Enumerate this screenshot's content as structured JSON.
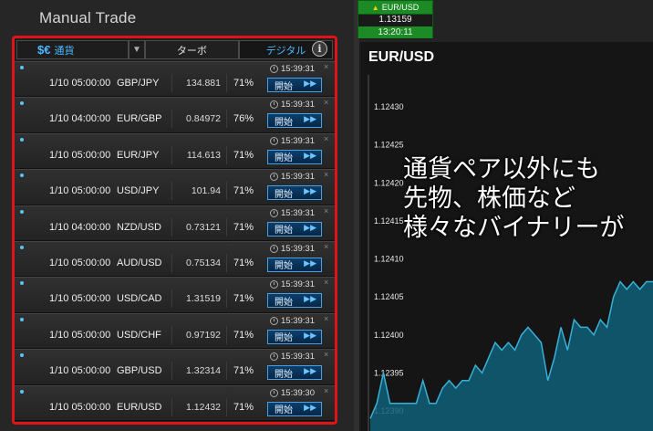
{
  "panel": {
    "title": "Manual Trade"
  },
  "tabs": {
    "currency_symbol": "$€",
    "currency_label": "通貨",
    "dropdown": "▼",
    "turbo": "ターボ",
    "digital": "デジタル",
    "info": "i"
  },
  "trades": [
    {
      "date": "1/10 05:00:00",
      "pair": "GBP/JPY",
      "rate": "134.881",
      "payout": "71%",
      "time": "15:39:31",
      "button": "開始"
    },
    {
      "date": "1/10 04:00:00",
      "pair": "EUR/GBP",
      "rate": "0.84972",
      "payout": "76%",
      "time": "15:39:31",
      "button": "開始"
    },
    {
      "date": "1/10 05:00:00",
      "pair": "EUR/JPY",
      "rate": "114.613",
      "payout": "71%",
      "time": "15:39:31",
      "button": "開始"
    },
    {
      "date": "1/10 05:00:00",
      "pair": "USD/JPY",
      "rate": "101.94",
      "payout": "71%",
      "time": "15:39:31",
      "button": "開始"
    },
    {
      "date": "1/10 04:00:00",
      "pair": "NZD/USD",
      "rate": "0.73121",
      "payout": "71%",
      "time": "15:39:31",
      "button": "開始"
    },
    {
      "date": "1/10 05:00:00",
      "pair": "AUD/USD",
      "rate": "0.75134",
      "payout": "71%",
      "time": "15:39:31",
      "button": "開始"
    },
    {
      "date": "1/10 05:00:00",
      "pair": "USD/CAD",
      "rate": "1.31519",
      "payout": "71%",
      "time": "15:39:31",
      "button": "開始"
    },
    {
      "date": "1/10 05:00:00",
      "pair": "USD/CHF",
      "rate": "0.97192",
      "payout": "71%",
      "time": "15:39:31",
      "button": "開始"
    },
    {
      "date": "1/10 05:00:00",
      "pair": "GBP/USD",
      "rate": "1.32314",
      "payout": "71%",
      "time": "15:39:31",
      "button": "開始"
    },
    {
      "date": "1/10 05:00:00",
      "pair": "EUR/USD",
      "rate": "1.12432",
      "payout": "71%",
      "time": "15:39:30",
      "button": "開始"
    }
  ],
  "ticker": {
    "pair": "EUR/USD",
    "price": "1.13159",
    "time": "13:20:11"
  },
  "chart": {
    "title": "EUR/USD",
    "y_ticks": [
      "1.12430",
      "1.12425",
      "1.12420",
      "1.12415",
      "1.12410",
      "1.12405",
      "1.12400",
      "1.12395",
      "1.12390"
    ],
    "line_color": "#39b0d6",
    "fill_color": "#0f5f78"
  },
  "chart_data": {
    "type": "area",
    "ylim": [
      1.1239,
      1.1243
    ],
    "series": [
      {
        "values": [
          1.12389,
          1.12391,
          1.12395,
          1.12391,
          1.12391,
          1.12391,
          1.12391,
          1.12391,
          1.12394,
          1.12391,
          1.12391,
          1.12393,
          1.12394,
          1.12393,
          1.12394,
          1.12394,
          1.12396,
          1.12395,
          1.12397,
          1.12399,
          1.12398,
          1.12399,
          1.12398,
          1.124,
          1.12401,
          1.124,
          1.12399,
          1.12394,
          1.12397,
          1.12401,
          1.12398,
          1.12402,
          1.12401,
          1.12401,
          1.124,
          1.12402,
          1.12401,
          1.12405,
          1.12407,
          1.12406,
          1.12407,
          1.12406,
          1.12407,
          1.12407
        ]
      }
    ]
  },
  "overlay": {
    "line1": "通貨ペア以外にも",
    "line2": "先物、株価など",
    "line3": "様々なバイナリーが"
  }
}
